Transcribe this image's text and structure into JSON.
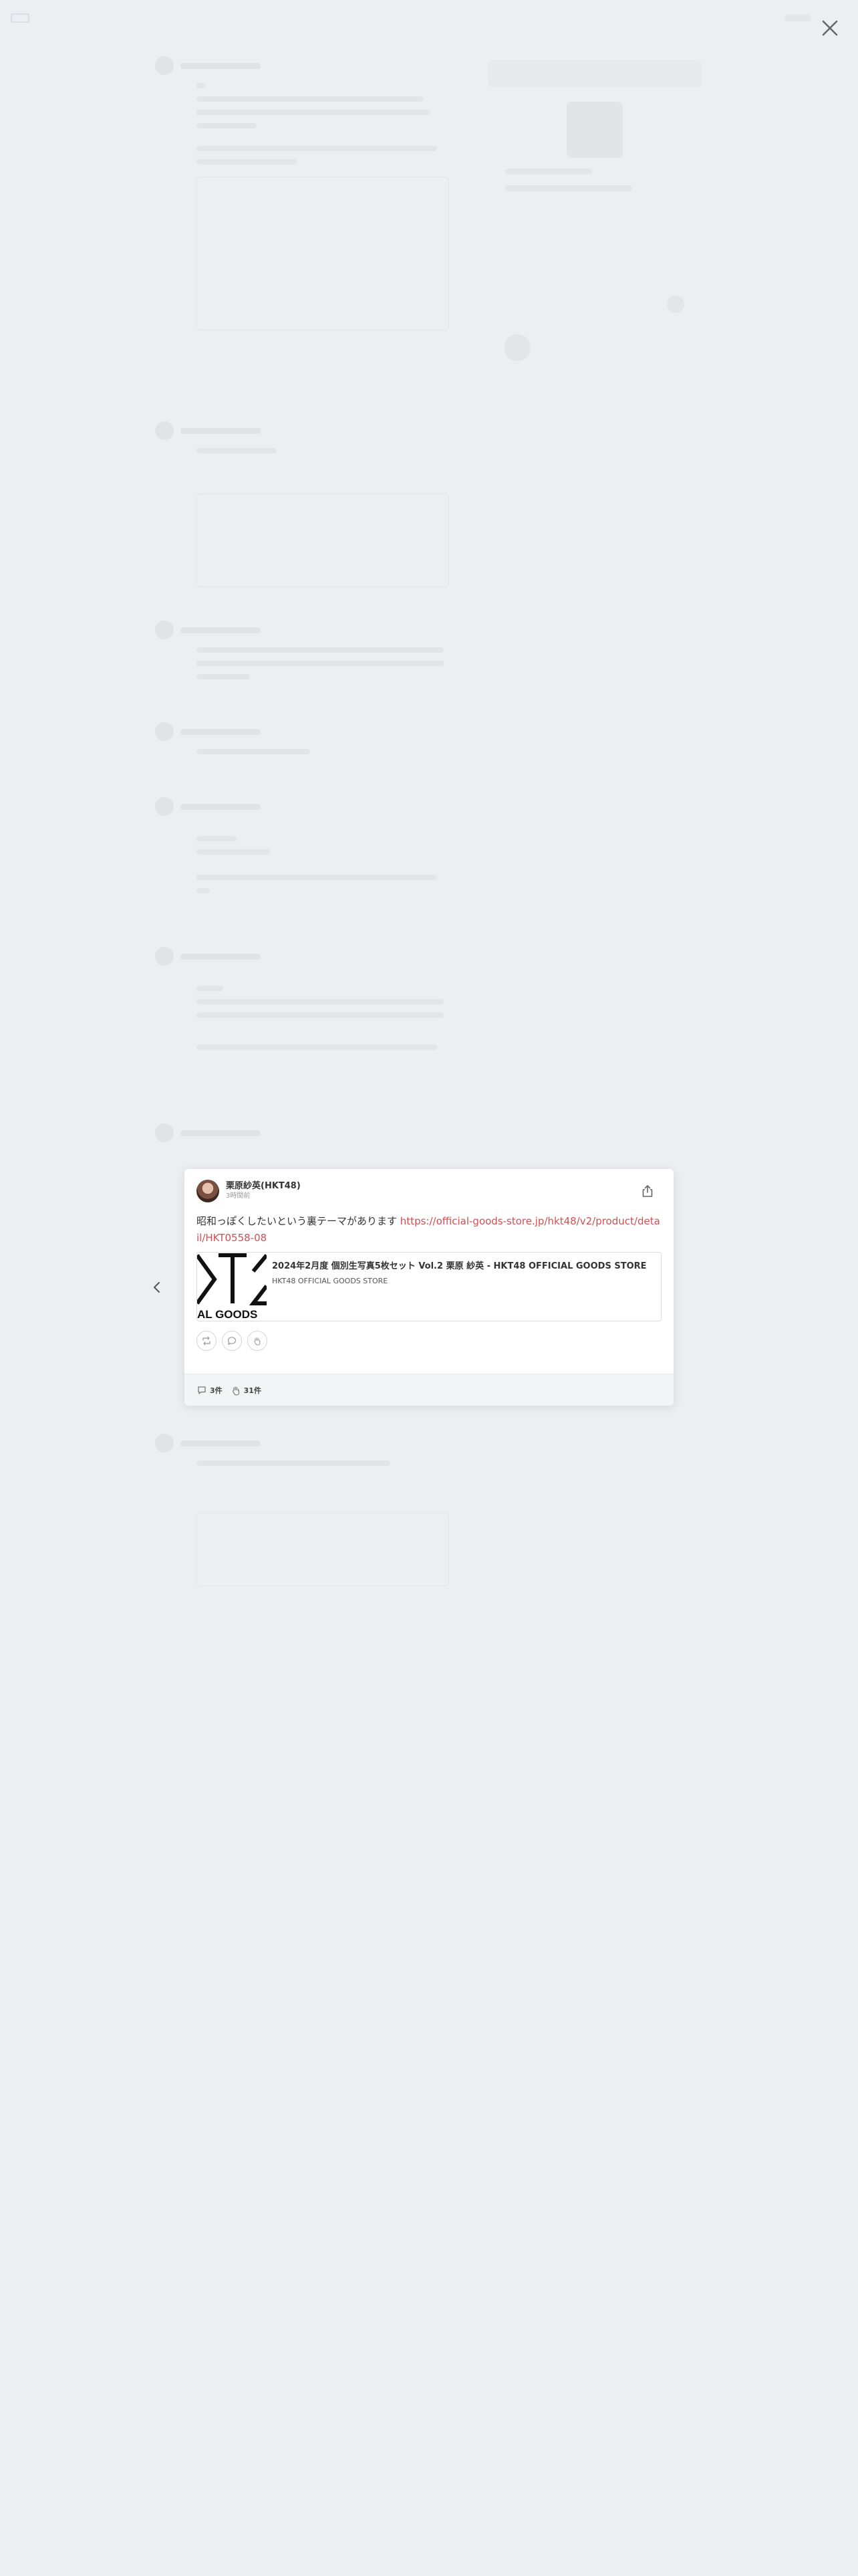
{
  "post": {
    "author_name": "栗原紗英(HKT48)",
    "time_ago": "3時間前",
    "text": "昭和っぽくしたいという裏テーマがあります",
    "link_url": "https://official-goods-store.jp/hkt48/v2/product/detail/HKT0558-08",
    "link_card": {
      "title": "2024年2月度 個別生写真5枚セット Vol.2 栗原 紗英 - HKT48 OFFICIAL GOODS STORE",
      "site": "HKT48 OFFICIAL GOODS STORE",
      "thumb_text": "AL GOODS"
    },
    "stats": {
      "replies": "3件",
      "reactions": "31件"
    }
  },
  "icons": {
    "close": "close-icon",
    "prev": "chevron-left-icon",
    "share": "share-icon",
    "repost": "repost-icon",
    "reply": "reply-icon",
    "reaction": "reaction-icon",
    "accent": "#d24f53"
  }
}
